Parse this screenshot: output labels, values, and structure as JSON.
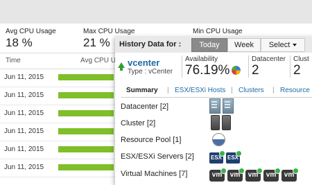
{
  "stats": [
    {
      "label": "Avg CPU Usage",
      "value": "18 %"
    },
    {
      "label": "Max CPU Usage",
      "value": "21 %"
    },
    {
      "label": "Min CPU Usage",
      "value": ""
    }
  ],
  "table": {
    "headers": [
      "Time",
      "Avg CPU Usa"
    ],
    "rows": [
      {
        "date": "Jun 11, 2015",
        "bar_fraction": 0.55
      },
      {
        "date": "Jun 11, 2015",
        "bar_fraction": 0.55
      },
      {
        "date": "Jun 11, 2015",
        "bar_fraction": 0.55
      },
      {
        "date": "Jun 11, 2015",
        "bar_fraction": 0.55
      },
      {
        "date": "Jun 11, 2015",
        "bar_fraction": 0.55
      },
      {
        "date": "Jun 11, 2015",
        "bar_fraction": 0.55
      }
    ]
  },
  "popup": {
    "title": "History Data for :",
    "tabs": [
      "Today",
      "Week",
      "Select"
    ],
    "active_tab": "Today",
    "entity": {
      "name": "vcenter",
      "type": "Type : vCenter",
      "status_icon": "arrow-up-icon",
      "status_color": "#2fa02f"
    },
    "metrics": [
      {
        "label": "Availability",
        "value": "76.19%"
      },
      {
        "label": "Datacenter",
        "value": "2"
      },
      {
        "label": "Clust",
        "value": "2"
      }
    ],
    "subtabs": [
      "Summary",
      "ESX/ESXi Hosts",
      "Clusters",
      "Resource"
    ],
    "inventory": [
      {
        "label": "Datacenter [2]",
        "icon": "datacenter-icon",
        "count": 2
      },
      {
        "label": "Cluster [2]",
        "icon": "cluster-icon",
        "count": 2
      },
      {
        "label": "Resource Pool [1]",
        "icon": "resource-pool-icon",
        "count": 1
      },
      {
        "label": "ESX/ESXi Servers [2]",
        "icon": "esx-server-icon",
        "count": 2,
        "badge_text": "ESX"
      },
      {
        "label": "Virtual Machines [7]",
        "icon": "vm-icon",
        "count": 5,
        "badge_text": "vm"
      }
    ]
  },
  "colors": {
    "bar": "#7fbf2a",
    "link": "#1b6aa5",
    "active_tab": "#8a8a8a"
  }
}
